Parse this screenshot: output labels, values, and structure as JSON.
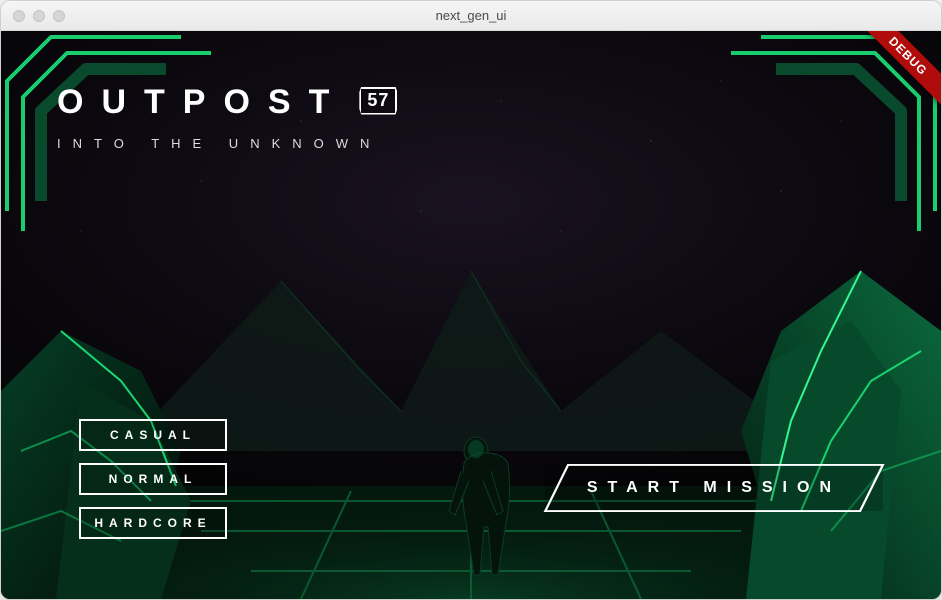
{
  "window": {
    "title": "next_gen_ui"
  },
  "debug_ribbon": "DEBUG",
  "title": {
    "main": "OUTPOST",
    "badge": "57",
    "subtitle": "INTO THE UNKNOWN"
  },
  "difficulty": {
    "options": [
      {
        "label": "CASUAL"
      },
      {
        "label": "NORMAL"
      },
      {
        "label": "HARDCORE"
      }
    ]
  },
  "start_button": {
    "label": "START MISSION"
  },
  "colors": {
    "neon_green": "#2fe67a",
    "neon_green_dark": "#0d6b3a",
    "accent_cyan": "#59ffc4",
    "ribbon_red": "#b10c0c"
  }
}
